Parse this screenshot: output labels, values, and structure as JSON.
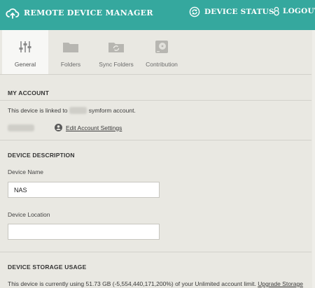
{
  "header": {
    "title": "REMOTE DEVICE MANAGER",
    "status_label": "DEVICE STATUS",
    "logout_label": "LOGOUT"
  },
  "tabs": [
    {
      "label": "General",
      "icon": "sliders-icon",
      "active": true
    },
    {
      "label": "Folders",
      "icon": "folder-icon",
      "active": false
    },
    {
      "label": "Sync Folders",
      "icon": "sync-folder-icon",
      "active": false
    },
    {
      "label": "Contribution",
      "icon": "disk-icon",
      "active": false
    }
  ],
  "account": {
    "heading": "MY ACCOUNT",
    "linked_prefix": "This device is linked to",
    "linked_name": "xxxxxx",
    "linked_suffix": "symform account.",
    "user_redacted": "xxxxxxxxx",
    "edit_label": "Edit Account Settings"
  },
  "description": {
    "heading": "DEVICE DESCRIPTION",
    "name_label": "Device Name",
    "name_value": "NAS",
    "location_label": "Device Location",
    "location_value": ""
  },
  "storage": {
    "heading": "DEVICE STORAGE USAGE",
    "text": "This device is currently using 51.73 GB (-5,554,440,171,200%) of your Unlimited account limit.",
    "upgrade_label": "Upgrade Storage"
  },
  "colors": {
    "header_bg": "#35a89e",
    "page_bg": "#e9e8e2",
    "active_tab_bg": "#f7f7f5"
  }
}
